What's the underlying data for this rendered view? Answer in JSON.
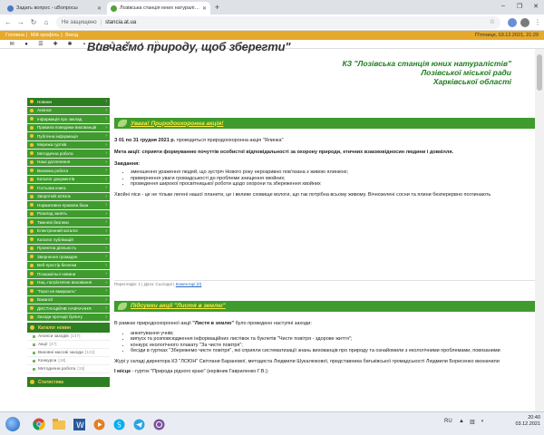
{
  "browser": {
    "tabs": [
      {
        "title": "Задать вопрос - uВопросы",
        "icon": "question-favicon"
      },
      {
        "title": "Лозівська станція юних натуралістів",
        "icon": "site-favicon"
      }
    ],
    "address": {
      "security": "Не защищено",
      "url": "stancia.at.ua"
    }
  },
  "site": {
    "top_links": [
      "Головна",
      "Мій профіль",
      "Вихід"
    ],
    "datetime": "П'ятниця, 03.12.2021, 21:29",
    "motto": "Вивчаємо природу, щоб зберегти\"",
    "org": {
      "line1": "КЗ \"Лозівська станція юних натуралістів\"",
      "line2": "Лозівської міської ради",
      "line3": "Харківської області"
    }
  },
  "sidebar": {
    "items": [
      "Новини",
      "Анонси",
      "Інформація про заклад",
      "Правила поведінки вихованців",
      "Публічна інформація",
      "Мережа гуртків",
      "Методична робота",
      "Наші досягнення",
      "Виховна робота",
      "Каталог документів",
      "Гостьова книга",
      "Зворотній зв'язок",
      "Нормативно-правова база",
      "Розклад занять",
      "Тижневі безпеки",
      "Електронний каталог",
      "Каталог публікацій",
      "Проектна діяльність",
      "Звернення громадян",
      "Веб-простір безпеки",
      "Позашкільні новини",
      "Нац.-патріотичне виховання",
      "\"Герої не вмирають\"",
      "Вакансії",
      "ДИСТАНЦІЙНЕ НАВЧАННЯ",
      "Заходи протидії булінгу"
    ],
    "section_title": "Каталог новин",
    "subitems": [
      {
        "label": "Анонси заходів",
        "count": "[147]"
      },
      {
        "label": "Акції",
        "count": "[47]"
      },
      {
        "label": "Виховні масові заходи",
        "count": "[122]"
      },
      {
        "label": "Конкурси",
        "count": "[18]"
      },
      {
        "label": "Методична робота",
        "count": "[15]"
      }
    ],
    "section2_title": "Статистика"
  },
  "posts": {
    "p1": {
      "title": "Увага! Природоохоронна акція!",
      "lead_date": "З 01 по 31 грудня 2021 р.",
      "lead_rest": "проводиться природоохоронна акція \"Ялинка\"",
      "goal": "Мета акції: сприяти формуванню почуттів особистої відповідальності за охорону природи, етичних взаємовідносин людини і довкілля.",
      "tasks_label": "Завдання:",
      "tasks": [
        "зменшення ураження людей, що зустріч Нового року нерозривно пов'язана з живою ялинкою;",
        "привернення уваги громадськості до проблеми знищення хвойних;",
        "проведення широкої просвітницької роботи щодо охорони та збереження хвойних"
      ],
      "body": "Хвойні ліси - це не тільки легені нашої планети, це і велике сховище вологи, що так потрібна всьому живому. Вічнозелені сосни та ялини безперервно поглинають",
      "meta": "Переглядів: 1 | Дата: Сьогодні |",
      "meta_link": "Коментарі (0)"
    },
    "p2": {
      "title": "Підсумки акції \"Листя в землю\"",
      "intro_pre": "В рамках природоохоронної акції",
      "intro_bold": "\"Листя в землю\"",
      "intro_post": "було проведено наступні заходи:",
      "items": [
        "анкетування учнів;",
        "випуск та розповсюдження інформаційних листівок та буклетів \"Чисте повітря - здорове життя\";",
        "конкурс екологічного плакату \"За чисте повітря\";",
        "бесіди в гуртках \"Збережемо чисте повітря\", які сприяли систематизації знань вихованців про природу та ознайомили з екологічними проблемами, повязаними"
      ],
      "jury": "Журі у складі директора КЗ \"ЛСЮН\" Світлани Баранової, методиста Людмили Шукалюкової, представника батьківської громадськості Людмили Борисенко визначили",
      "place": "І місце",
      "place_rest": "- гурток \"Природа рідного краю\" (керівник Гавриленко Г.В.);"
    }
  },
  "taskbar": {
    "lang": "RU",
    "time": "20:40",
    "date": "03.12.2021"
  }
}
